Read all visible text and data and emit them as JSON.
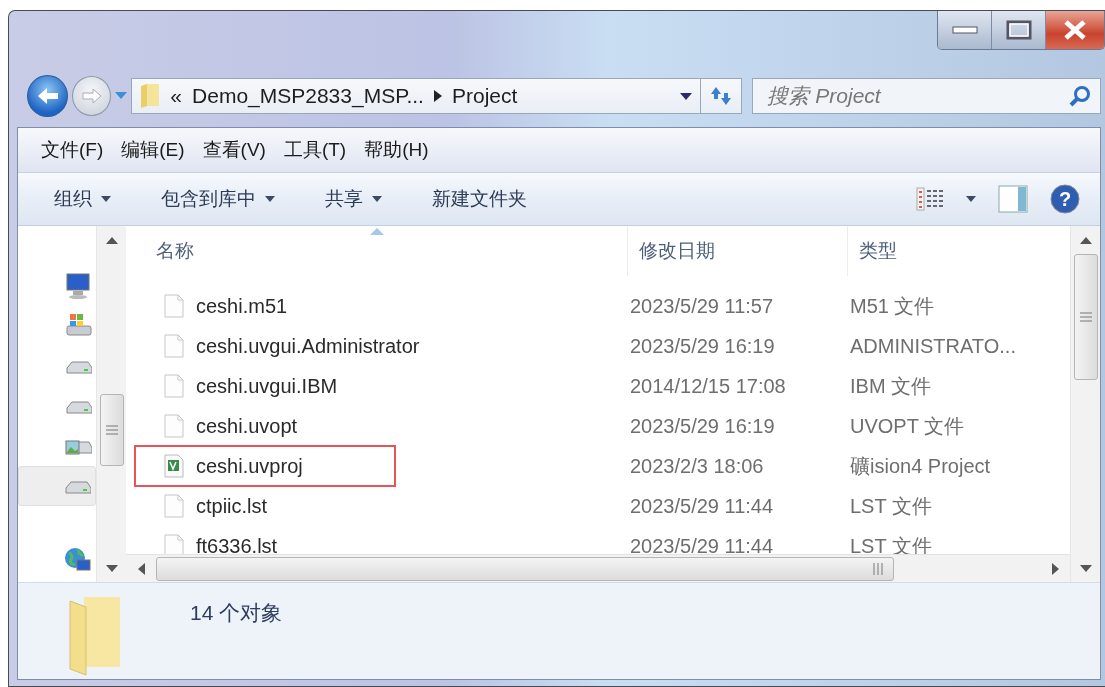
{
  "address": {
    "overflow": "«",
    "crumbs": [
      "Demo_MSP2833_MSP...",
      "Project"
    ]
  },
  "search": {
    "placeholder": "搜索 Project"
  },
  "menu": [
    "文件(F)",
    "编辑(E)",
    "查看(V)",
    "工具(T)",
    "帮助(H)"
  ],
  "toolbar": [
    {
      "label": "组织",
      "dropdown": true
    },
    {
      "label": "包含到库中",
      "dropdown": true
    },
    {
      "label": "共享",
      "dropdown": true
    },
    {
      "label": "新建文件夹",
      "dropdown": false
    }
  ],
  "help": "?",
  "nav_items": [
    {
      "kind": "computer",
      "selected": false
    },
    {
      "kind": "windows-drive",
      "selected": false
    },
    {
      "kind": "drive",
      "selected": false
    },
    {
      "kind": "drive",
      "selected": false
    },
    {
      "kind": "picture-drive",
      "selected": false
    },
    {
      "kind": "drive",
      "selected": true
    },
    {
      "kind": "network",
      "selected": false
    }
  ],
  "columns": [
    {
      "label": "名称",
      "sorted": true
    },
    {
      "label": "修改日期",
      "sorted": false
    },
    {
      "label": "类型",
      "sorted": false
    }
  ],
  "rows": [
    {
      "name": "ceshi.m51",
      "date": "2023/5/29 11:57",
      "type": "M51 文件",
      "kind": "blank",
      "highlighted": false
    },
    {
      "name": "ceshi.uvgui.Administrator",
      "date": "2023/5/29 16:19",
      "type": "ADMINISTRATO...",
      "kind": "blank",
      "highlighted": false
    },
    {
      "name": "ceshi.uvgui.IBM",
      "date": "2014/12/15 17:08",
      "type": "IBM 文件",
      "kind": "blank",
      "highlighted": false
    },
    {
      "name": "ceshi.uvopt",
      "date": "2023/5/29 16:19",
      "type": "UVOPT 文件",
      "kind": "blank",
      "highlighted": false
    },
    {
      "name": "ceshi.uvproj",
      "date": "2023/2/3 18:06",
      "type": "礦ision4 Project",
      "kind": "project",
      "highlighted": true
    },
    {
      "name": "ctpiic.lst",
      "date": "2023/5/29 11:44",
      "type": "LST 文件",
      "kind": "blank",
      "highlighted": false
    },
    {
      "name": "ft6336.lst",
      "date": "2023/5/29 11:44",
      "type": "LST 文件",
      "kind": "blank",
      "highlighted": false
    }
  ],
  "status_bar": {
    "text": "14 个对象"
  }
}
